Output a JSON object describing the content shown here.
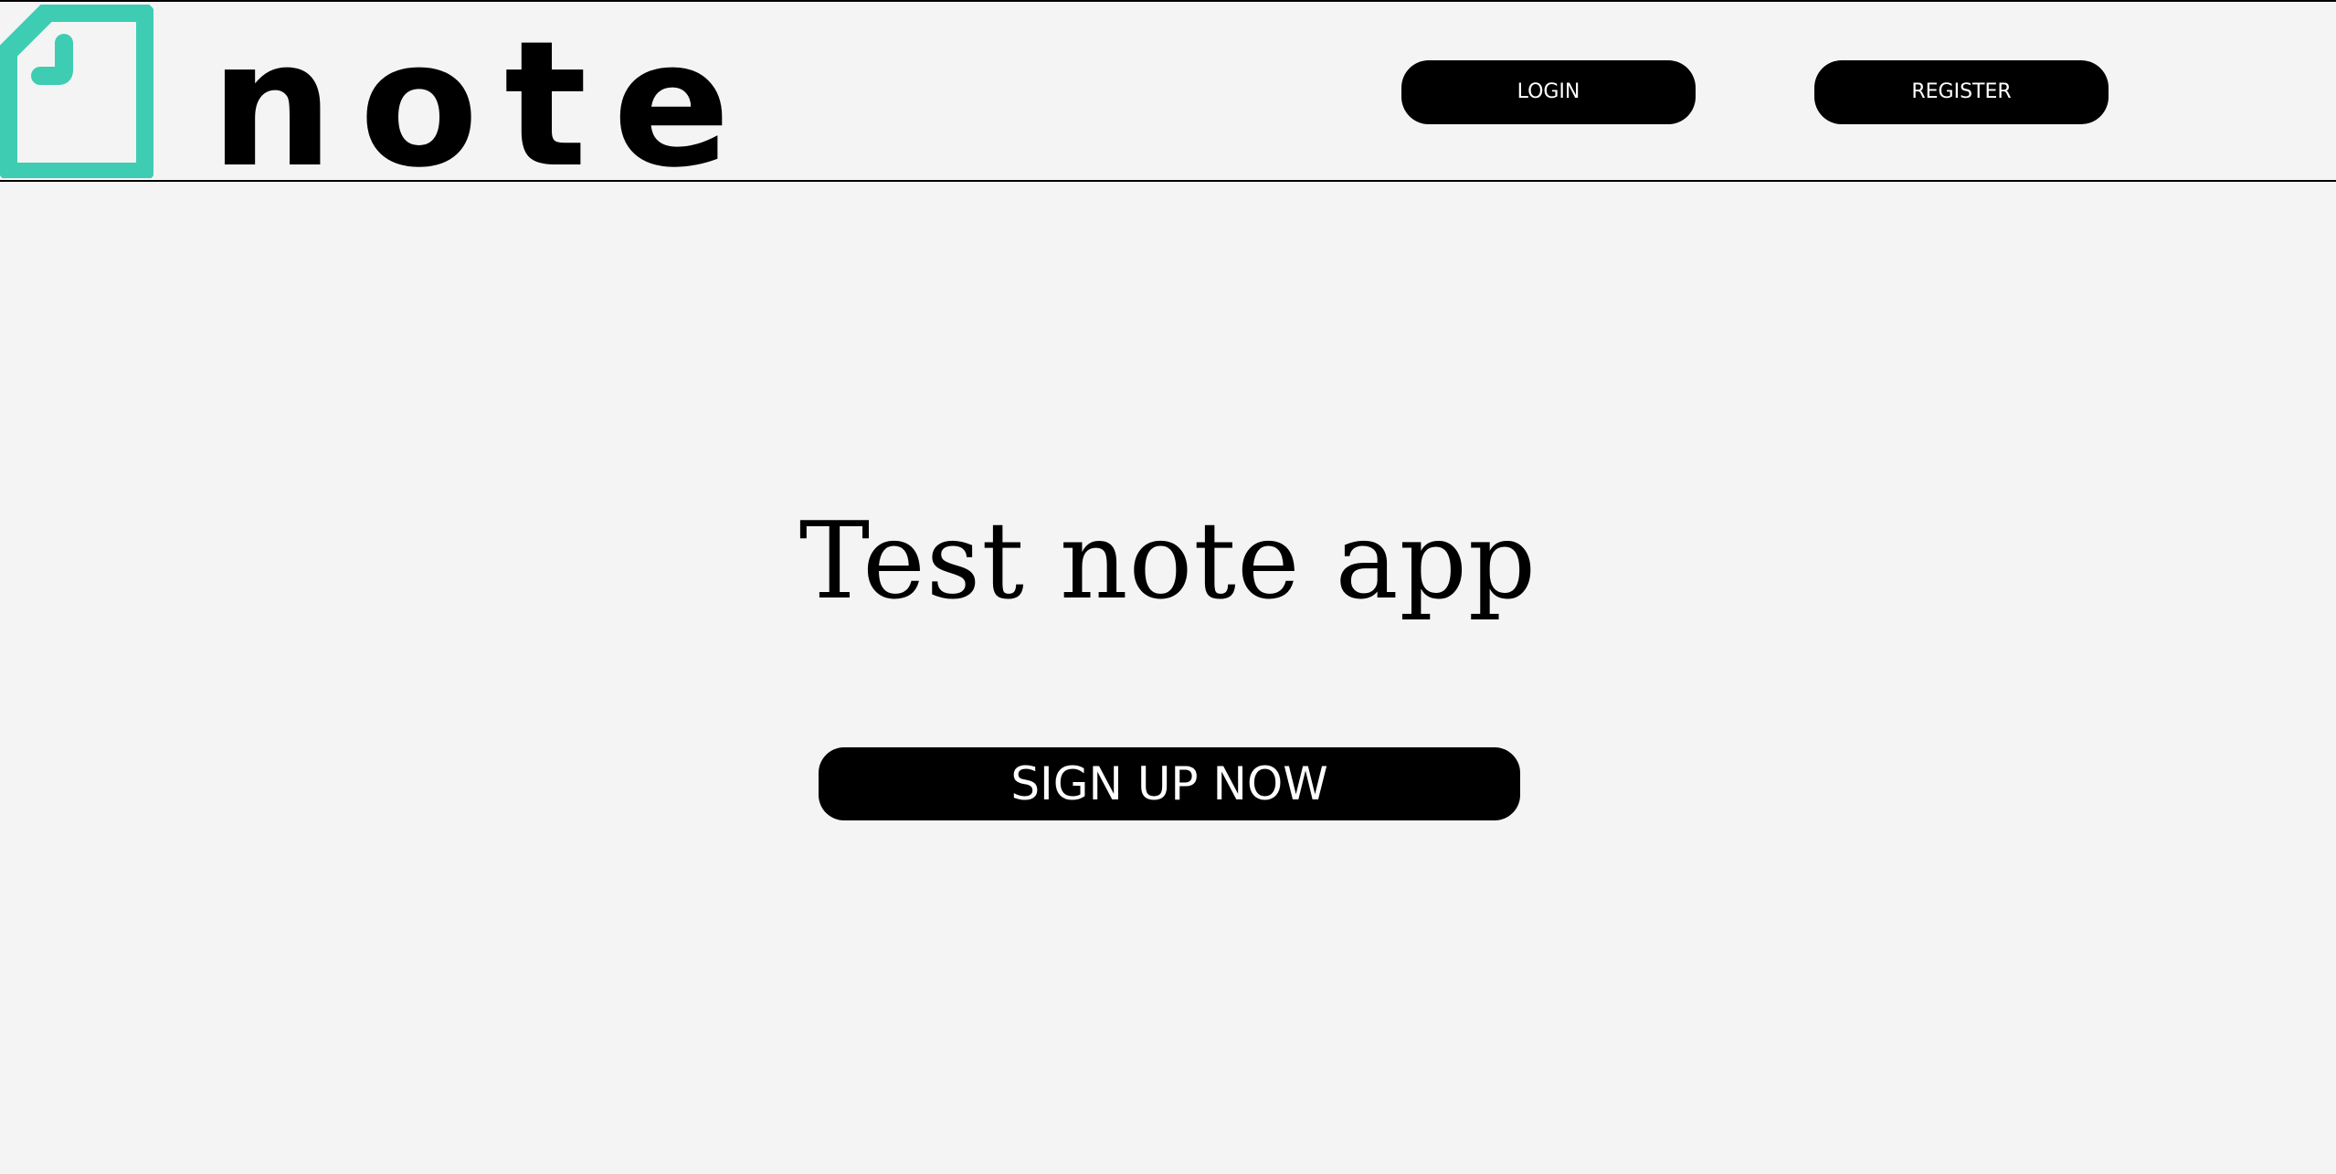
{
  "header": {
    "logo": {
      "wordmark": "note",
      "icon": "note-page-icon",
      "icon_color": "#3ecdb3"
    },
    "login_label": "LOGIN",
    "register_label": "REGISTER"
  },
  "main": {
    "title": "Test note app",
    "signup_label": "SIGN UP NOW"
  },
  "colors": {
    "background": "#f4f4f4",
    "button": "#000000",
    "button_text": "#ffffff",
    "accent": "#3ecdb3"
  }
}
